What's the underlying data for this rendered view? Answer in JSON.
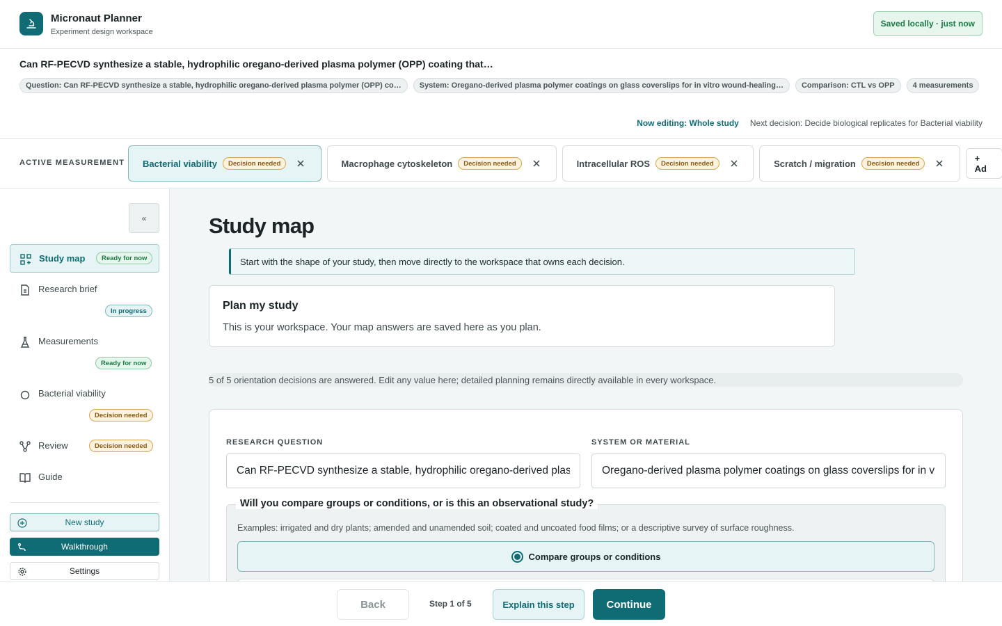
{
  "app": {
    "title": "Micronaut Planner",
    "subtitle": "Experiment design workspace",
    "saved_status": "Saved locally · just now"
  },
  "study": {
    "title": "Can RF-PECVD synthesize a stable, hydrophilic oregano-derived plasma polymer (OPP) coating that…",
    "chips": [
      "Question: Can RF-PECVD synthesize a stable, hydrophilic oregano-derived plasma polymer (OPP) co…",
      "System: Oregano-derived plasma polymer coatings on glass coverslips for in vitro wound-healing…",
      "Comparison: CTL vs OPP",
      "4 measurements"
    ],
    "now_editing": "Now editing: Whole study",
    "next_decision": "Next decision: Decide biological replicates for Bacterial viability"
  },
  "measurement_bar": {
    "label": "ACTIVE MEASUREMENT",
    "tabs": [
      {
        "label": "Bacterial viability",
        "badge": "Decision needed"
      },
      {
        "label": "Macrophage cytoskeleton",
        "badge": "Decision needed"
      },
      {
        "label": "Intracellular ROS",
        "badge": "Decision needed"
      },
      {
        "label": "Scratch / migration",
        "badge": "Decision needed"
      }
    ],
    "add_label": "+ Ad"
  },
  "sidebar": {
    "collapse_label": "«",
    "items": [
      {
        "label": "Study map",
        "badge": "Ready for now"
      },
      {
        "label": "Research brief",
        "badge": "In progress"
      },
      {
        "label": "Measurements",
        "badge": "Ready for now"
      },
      {
        "label": "Bacterial viability",
        "badge": "Decision needed"
      },
      {
        "label": "Review",
        "badge": "Decision needed"
      },
      {
        "label": "Guide"
      }
    ],
    "new_study": "New study",
    "walkthrough": "Walkthrough",
    "settings": "Settings"
  },
  "main": {
    "page_title": "Study map",
    "banner": "Start with the shape of your study, then move directly to the workspace that owns each decision.",
    "plan_card": {
      "title": "Plan my study",
      "text": "This is your workspace. Your map answers are saved here as you plan."
    },
    "progress_text": "5 of 5 orientation decisions are answered. Edit any value here; detailed planning remains directly available in every workspace.",
    "form": {
      "research_question_label": "RESEARCH QUESTION",
      "research_question_value": "Can RF-PECVD synthesize a stable, hydrophilic oregano-derived plasma polymer (OPP) coating that…",
      "system_label": "SYSTEM OR MATERIAL",
      "system_value": "Oregano-derived plasma polymer coatings on glass coverslips for in vitro wound-healing studies",
      "compare_question": "Will you compare groups or conditions, or is this an observational study?",
      "examples": "Examples: irrigated and dry plants; amended and unamended soil; coated and uncoated food films; or a descriptive survey of surface roughness.",
      "option_selected": "Compare groups or conditions"
    }
  },
  "footer": {
    "back": "Back",
    "step": "Step 1 of 5",
    "explain": "Explain this step",
    "continue": "Continue"
  },
  "colors": {
    "accent": "#0f6c74",
    "ready": "#1e7a47",
    "decision": "#8a5a12"
  }
}
